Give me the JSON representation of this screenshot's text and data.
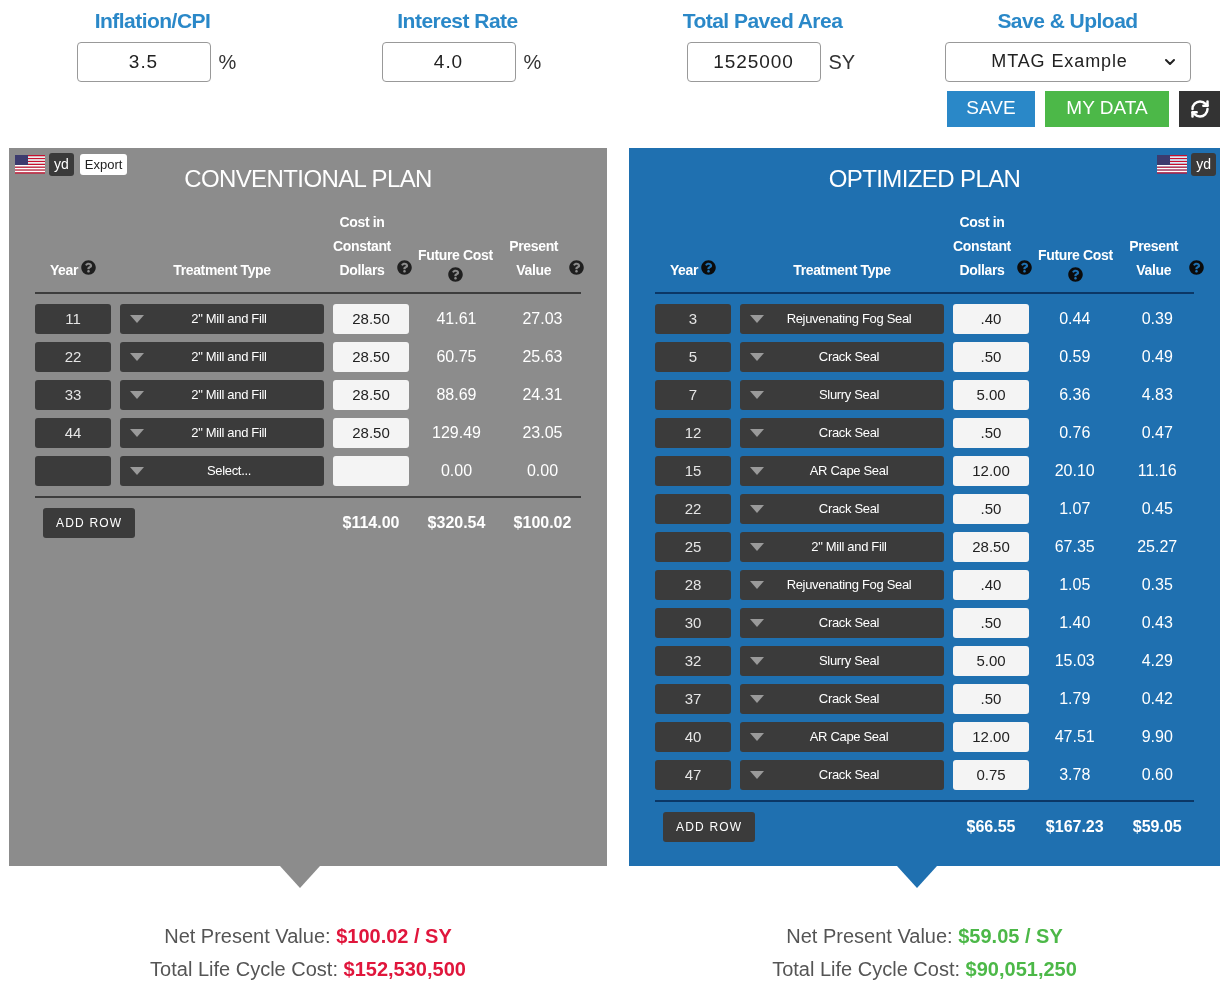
{
  "inputs": [
    {
      "label": "Inflation/CPI",
      "value": "3.5",
      "unit": "%"
    },
    {
      "label": "Interest Rate",
      "value": "4.0",
      "unit": "%"
    },
    {
      "label": "Total Paved Area",
      "value": "1525000",
      "unit": "SY"
    }
  ],
  "save_upload": {
    "label": "Save & Upload",
    "select_value": "MTAG Example",
    "save_button": "SAVE",
    "my_data_button": "MY DATA"
  },
  "plans": [
    {
      "kind": "conventional",
      "title": "CONVENTIONAL PLAN",
      "unit_badge": "yd",
      "export_button": "Export",
      "columns": [
        {
          "label": "Year",
          "help": true
        },
        {
          "label": "Treatment Type",
          "help": false
        },
        {
          "label": "Cost in Constant Dollars",
          "help": true
        },
        {
          "label": "Future Cost",
          "help": true
        },
        {
          "label": "Present Value",
          "help": true
        }
      ],
      "rows": [
        {
          "year": "11",
          "treatment": "2\" Mill and Fill",
          "cost": "28.50",
          "future": "41.61",
          "present": "27.03"
        },
        {
          "year": "22",
          "treatment": "2\" Mill and Fill",
          "cost": "28.50",
          "future": "60.75",
          "present": "25.63"
        },
        {
          "year": "33",
          "treatment": "2\" Mill and Fill",
          "cost": "28.50",
          "future": "88.69",
          "present": "24.31"
        },
        {
          "year": "44",
          "treatment": "2\" Mill and Fill",
          "cost": "28.50",
          "future": "129.49",
          "present": "23.05"
        },
        {
          "treatment": "Select...",
          "future": "0.00",
          "present": "0.00"
        }
      ],
      "add_row": "ADD ROW",
      "totals": [
        "$114.00",
        "$320.54",
        "$100.02"
      ],
      "summary": {
        "npv_label": "Net Present Value:",
        "npv_value": "$100.02 / SY",
        "lcc_label": "Total Life Cycle Cost:",
        "lcc_value": "$152,530,500",
        "color": "#e0163c"
      }
    },
    {
      "kind": "optimized",
      "title": "OPTIMIZED PLAN",
      "unit_badge": "yd",
      "columns": [
        {
          "label": "Year",
          "help": true
        },
        {
          "label": "Treatment Type",
          "help": false
        },
        {
          "label": "Cost in Constant Dollars",
          "help": true
        },
        {
          "label": "Future Cost",
          "help": true
        },
        {
          "label": "Present Value",
          "help": true
        }
      ],
      "rows": [
        {
          "year": "3",
          "treatment": "Rejuvenating Fog Seal",
          "cost": ".40",
          "future": "0.44",
          "present": "0.39"
        },
        {
          "year": "5",
          "treatment": "Crack Seal",
          "cost": ".50",
          "future": "0.59",
          "present": "0.49"
        },
        {
          "year": "7",
          "treatment": "Slurry Seal",
          "cost": "5.00",
          "future": "6.36",
          "present": "4.83"
        },
        {
          "year": "12",
          "treatment": "Crack Seal",
          "cost": ".50",
          "future": "0.76",
          "present": "0.47"
        },
        {
          "year": "15",
          "treatment": "AR Cape Seal",
          "cost": "12.00",
          "future": "20.10",
          "present": "11.16"
        },
        {
          "year": "22",
          "treatment": "Crack Seal",
          "cost": ".50",
          "future": "1.07",
          "present": "0.45"
        },
        {
          "year": "25",
          "treatment": "2\" Mill and Fill",
          "cost": "28.50",
          "future": "67.35",
          "present": "25.27"
        },
        {
          "year": "28",
          "treatment": "Rejuvenating Fog Seal",
          "cost": ".40",
          "future": "1.05",
          "present": "0.35"
        },
        {
          "year": "30",
          "treatment": "Crack Seal",
          "cost": ".50",
          "future": "1.40",
          "present": "0.43"
        },
        {
          "year": "32",
          "treatment": "Slurry Seal",
          "cost": "5.00",
          "future": "15.03",
          "present": "4.29"
        },
        {
          "year": "37",
          "treatment": "Crack Seal",
          "cost": ".50",
          "future": "1.79",
          "present": "0.42"
        },
        {
          "year": "40",
          "treatment": "AR Cape Seal",
          "cost": "12.00",
          "future": "47.51",
          "present": "9.90"
        },
        {
          "year": "47",
          "treatment": "Crack Seal",
          "cost": "0.75",
          "future": "3.78",
          "present": "0.60"
        }
      ],
      "add_row": "ADD ROW",
      "totals": [
        "$66.55",
        "$167.23",
        "$59.05"
      ],
      "summary": {
        "npv_label": "Net Present Value:",
        "npv_value": "$59.05 / SY",
        "lcc_label": "Total Life Cycle Cost:",
        "lcc_value": "$90,051,250",
        "color": "#4cb848"
      }
    }
  ]
}
